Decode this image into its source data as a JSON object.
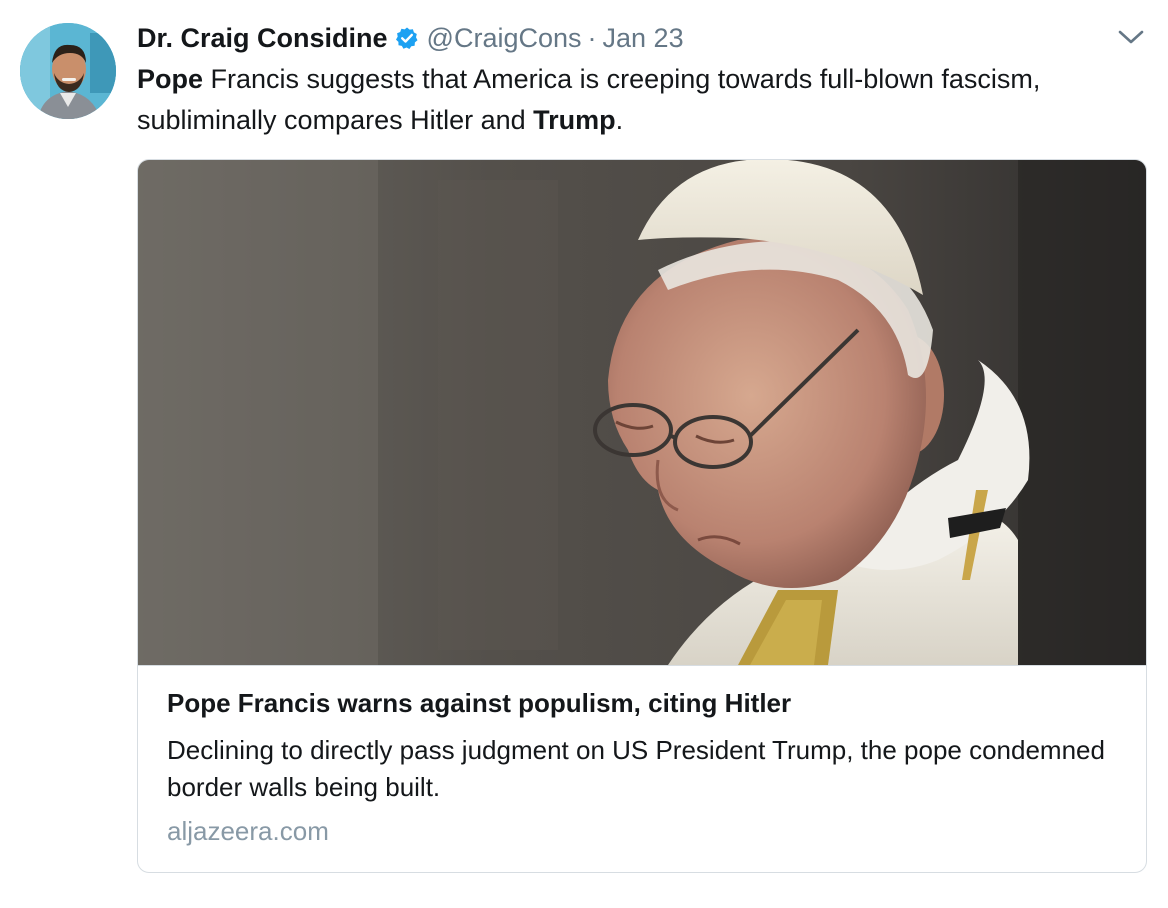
{
  "tweet": {
    "author": {
      "display_name": "Dr. Craig Considine",
      "handle": "@CraigCons",
      "verified": true,
      "verified_icon": "verified-badge-icon",
      "avatar": "avatar"
    },
    "separator": "·",
    "date": "Jan 23",
    "menu_icon": "chevron-down-icon",
    "text_parts": [
      {
        "text": "Pope",
        "bold": true
      },
      {
        "text": " Francis suggests that America is creeping towards full-blown fascism, subliminally compares Hitler and ",
        "bold": false
      },
      {
        "text": "Trump",
        "bold": true
      },
      {
        "text": ".",
        "bold": false
      }
    ],
    "card": {
      "image": "pope-francis-photo",
      "title": "Pope Francis warns against populism, citing Hitler",
      "description": "Declining to directly pass judgment on US President Trump, the pope condemned border walls being built.",
      "domain": "aljazeera.com"
    }
  },
  "colors": {
    "text_primary": "#14171a",
    "text_secondary": "#657786",
    "domain_gray": "#8899a6",
    "verified_blue": "#1da1f2",
    "card_border": "#d7dde2"
  }
}
